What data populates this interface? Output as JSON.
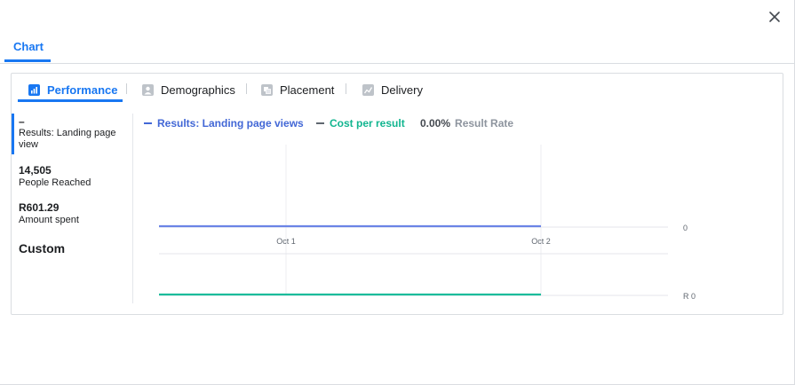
{
  "dialog": {
    "top_tab": "Chart"
  },
  "subtabs": [
    {
      "label": "Performance",
      "icon": "bar-chart-icon",
      "active": true
    },
    {
      "label": "Demographics",
      "icon": "people-icon",
      "active": false
    },
    {
      "label": "Placement",
      "icon": "placement-icon",
      "active": false
    },
    {
      "label": "Delivery",
      "icon": "line-chart-icon",
      "active": false
    }
  ],
  "sidebar": {
    "metrics": [
      {
        "value": "–",
        "label": "Results: Landing page view"
      },
      {
        "value": "14,505",
        "label": "People Reached"
      },
      {
        "value": "R601.29",
        "label": "Amount spent"
      }
    ],
    "custom_label": "Custom"
  },
  "legend": {
    "results": "Results: Landing page views",
    "cost": "Cost per result",
    "rate_value": "0.00%",
    "rate_label": "Result Rate"
  },
  "colors": {
    "accent": "#1877f2",
    "results_line": "#6b84e6",
    "cost_line": "#1bbc9b",
    "results_legend": "#4267d6",
    "cost_legend": "#11b58f"
  },
  "chart_data": [
    {
      "type": "line",
      "x": [
        "Oct 1",
        "Oct 2"
      ],
      "series": [
        {
          "name": "Results: Landing page views",
          "values": [
            0,
            0
          ]
        }
      ],
      "y_tick": "0"
    },
    {
      "type": "line",
      "x": [
        "Oct 1",
        "Oct 2"
      ],
      "series": [
        {
          "name": "Cost per result",
          "values": [
            0,
            0
          ]
        }
      ],
      "y_tick": "R 0"
    }
  ]
}
